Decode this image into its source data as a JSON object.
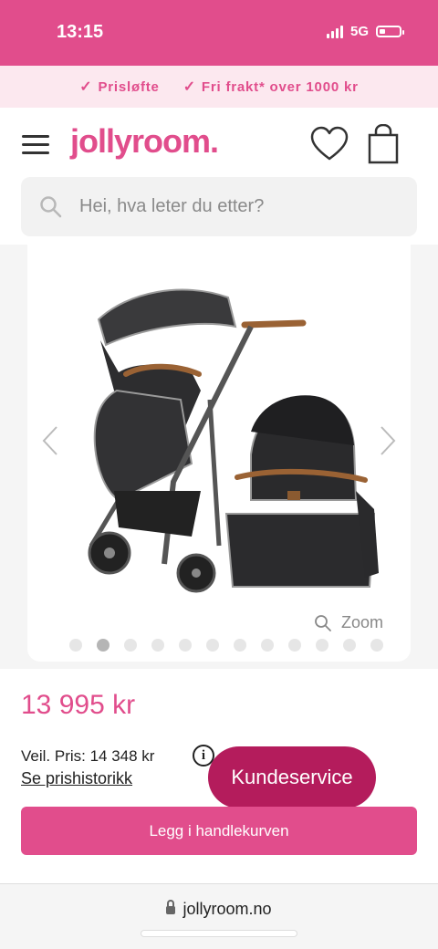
{
  "status_bar": {
    "time": "13:15",
    "network": "5G",
    "battery_level": 0.3
  },
  "promo": {
    "items": [
      "Prisløfte",
      "Fri frakt* over 1000 kr"
    ]
  },
  "header": {
    "logo": "jollyroom."
  },
  "search": {
    "placeholder": "Hei, hva leter du etter?"
  },
  "gallery": {
    "zoom_label": "Zoom",
    "dot_count": 12,
    "active_dot": 1
  },
  "product": {
    "price": "13 995 kr",
    "old_price_label": "Veil. Pris: 14 348 kr",
    "price_history_link": "Se prishistorikk",
    "info_glyph": "i"
  },
  "buttons": {
    "customer_service": "Kundeservice",
    "add_to_cart": "Legg i handlekurven"
  },
  "browser": {
    "url": "jollyroom.no"
  },
  "colors": {
    "brand_pink": "#e14d8c",
    "dark_pink": "#b41c5c",
    "promo_bg": "#fce8ef"
  }
}
